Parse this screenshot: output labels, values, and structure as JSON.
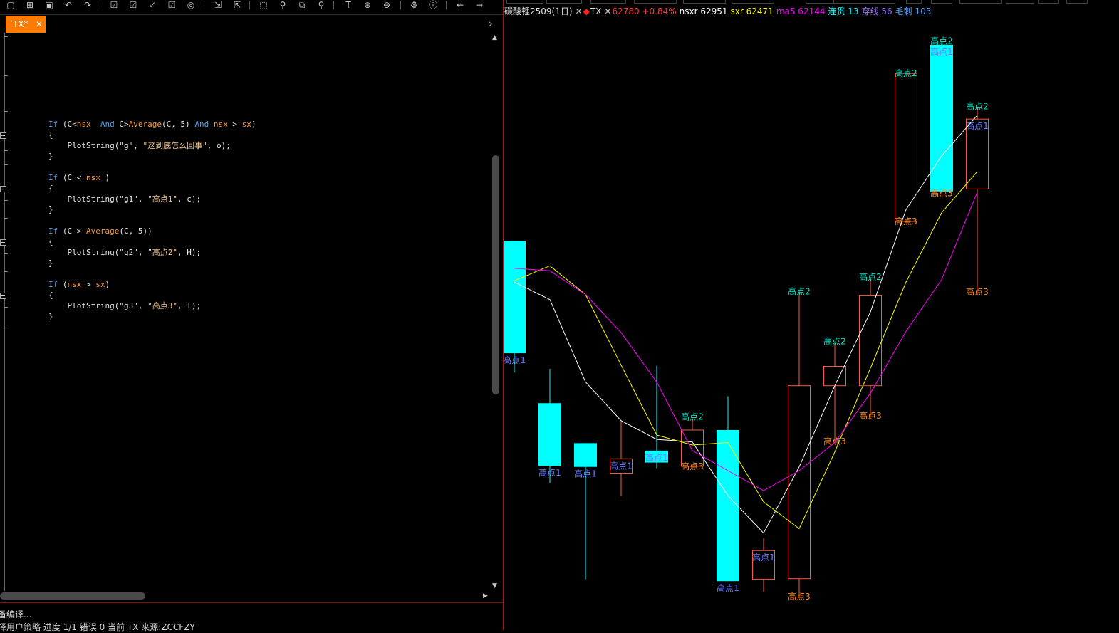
{
  "toolbar": {
    "icons": [
      "new-window-icon",
      "add-icon",
      "delete-icon",
      "undo-icon",
      "redo-icon",
      "check-icon",
      "check-doc-icon",
      "compile-icon",
      "check-all-icon",
      "stop-icon",
      "import-icon",
      "export-icon",
      "select-icon",
      "search-icon",
      "find-replace-icon",
      "zoom-search-icon",
      "text-cursor-icon",
      "zoom-in-icon",
      "zoom-out-icon",
      "settings-icon",
      "info-icon",
      "back-arrow-icon",
      "forward-arrow-icon"
    ]
  },
  "tab": {
    "label": "TX*",
    "close": "✕",
    "scroll_right": "›"
  },
  "editor": {
    "lines": [
      [
        {
          "c": "kw",
          "t": "If"
        },
        {
          "c": "tx",
          "t": " (C<"
        },
        {
          "c": "fn",
          "t": "nsx"
        },
        {
          "c": "tx",
          "t": "  "
        },
        {
          "c": "kw",
          "t": "And"
        },
        {
          "c": "tx",
          "t": " C>"
        },
        {
          "c": "fn",
          "t": "Average"
        },
        {
          "c": "tx",
          "t": "(C, 5) "
        },
        {
          "c": "kw",
          "t": "And"
        },
        {
          "c": "tx",
          "t": " "
        },
        {
          "c": "fn",
          "t": "nsx"
        },
        {
          "c": "tx",
          "t": " > "
        },
        {
          "c": "fn",
          "t": "sx"
        },
        {
          "c": "tx",
          "t": ")"
        }
      ],
      [
        {
          "c": "tx",
          "t": "{"
        }
      ],
      [
        {
          "c": "tx",
          "t": "    PlotString(\"g\", "
        },
        {
          "c": "st",
          "t": "\"这到底怎么回事\""
        },
        {
          "c": "tx",
          "t": ", o);"
        }
      ],
      [
        {
          "c": "tx",
          "t": "}"
        }
      ],
      [
        {
          "c": "kw",
          "t": "If"
        },
        {
          "c": "tx",
          "t": " (C < "
        },
        {
          "c": "fn",
          "t": "nsx"
        },
        {
          "c": "tx",
          "t": " )"
        }
      ],
      [
        {
          "c": "tx",
          "t": "{"
        }
      ],
      [
        {
          "c": "tx",
          "t": "    PlotString(\"g1\", "
        },
        {
          "c": "st",
          "t": "\"高点1\""
        },
        {
          "c": "tx",
          "t": ", c);"
        }
      ],
      [
        {
          "c": "tx",
          "t": "}"
        }
      ],
      [
        {
          "c": "kw",
          "t": "If"
        },
        {
          "c": "tx",
          "t": " (C > "
        },
        {
          "c": "fn",
          "t": "Average"
        },
        {
          "c": "tx",
          "t": "(C, 5))"
        }
      ],
      [
        {
          "c": "tx",
          "t": "{"
        }
      ],
      [
        {
          "c": "tx",
          "t": "    PlotString(\"g2\", "
        },
        {
          "c": "st",
          "t": "\"高点2\""
        },
        {
          "c": "tx",
          "t": ", H);"
        }
      ],
      [
        {
          "c": "tx",
          "t": "}"
        }
      ],
      [
        {
          "c": "kw",
          "t": "If"
        },
        {
          "c": "tx",
          "t": " ("
        },
        {
          "c": "fn",
          "t": "nsx"
        },
        {
          "c": "tx",
          "t": " > "
        },
        {
          "c": "fn",
          "t": "sx"
        },
        {
          "c": "tx",
          "t": ")"
        }
      ],
      [
        {
          "c": "tx",
          "t": "{"
        }
      ],
      [
        {
          "c": "tx",
          "t": "    PlotString(\"g3\", "
        },
        {
          "c": "st",
          "t": "\"高点3\""
        },
        {
          "c": "tx",
          "t": ", l);"
        }
      ],
      [
        {
          "c": "tx",
          "t": "}"
        }
      ]
    ]
  },
  "output": {
    "line1": "备编译...",
    "line2": "择用户策略  进度 1/1  错误 0  当前 TX 来源:ZCCFZY"
  },
  "chart": {
    "legend": [
      {
        "text": "碳酸锂2509(1日)",
        "color": "#e0e0e0"
      },
      {
        "text": "✕",
        "color": "#bbbbbb"
      },
      {
        "text": "◆",
        "color": "#ff2020"
      },
      {
        "text": "TX",
        "color": "#e0e0e0"
      },
      {
        "text": "✕",
        "color": "#bbbbbb"
      },
      {
        "text": "62780 +0.84%",
        "color": "#ff3b3b"
      },
      {
        "text": "nsxr 62951",
        "color": "#ffffff"
      },
      {
        "text": "sxr 62471",
        "color": "#ffff00"
      },
      {
        "text": "ma5 62144",
        "color": "#ff00ff"
      },
      {
        "text": "连贯 13",
        "color": "#00ffff"
      },
      {
        "text": "穿线 56",
        "color": "#a070ff"
      },
      {
        "text": "毛刺 103",
        "color": "#4d9fff"
      }
    ],
    "colors": {
      "up": "#ff5a3c",
      "down": "#00ffff",
      "nsxr": "#ffffff",
      "sxr": "#ffff00",
      "ma5": "#ff00ff",
      "g1": "#6b7dff",
      "g2": "#00e6c8",
      "g3": "#ff8c1a"
    }
  },
  "chart_data": {
    "type": "candlestick",
    "instrument": "碳酸锂2509",
    "candles": [
      {
        "o": 62800,
        "c": 61900,
        "h": 62800,
        "l": 61745,
        "dir": "down",
        "labels": [
          {
            "t": "高点1",
            "k": "g1"
          }
        ]
      },
      {
        "o": 61500,
        "c": 61000,
        "h": 61775,
        "l": 60860,
        "dir": "down",
        "labels": [
          {
            "t": "高点1",
            "k": "g1"
          }
        ]
      },
      {
        "o": 61180,
        "c": 60990,
        "h": 61180,
        "l": 60090,
        "dir": "down",
        "labels": [
          {
            "t": "高点1",
            "k": "g1"
          }
        ]
      },
      {
        "o": 60940,
        "c": 61055,
        "h": 61355,
        "l": 60755,
        "dir": "up",
        "labels": [
          {
            "t": "高点1",
            "k": "g1"
          }
        ]
      },
      {
        "o": 61025,
        "c": 61120,
        "h": 61800,
        "l": 60980,
        "dir": "down",
        "labels": [
          {
            "t": "高点1",
            "k": "g1"
          }
        ]
      },
      {
        "o": 60995,
        "c": 61285,
        "h": 61390,
        "l": 60995,
        "dir": "up",
        "labels": [
          {
            "t": "高点2",
            "k": "g2"
          },
          {
            "t": "高点3",
            "k": "g3"
          }
        ]
      },
      {
        "o": 61285,
        "c": 60075,
        "h": 61555,
        "l": 60075,
        "dir": "down",
        "labels": [
          {
            "t": "高点1",
            "k": "g1"
          }
        ]
      },
      {
        "o": 60090,
        "c": 60320,
        "h": 60420,
        "l": 59990,
        "dir": "up",
        "labels": [
          {
            "t": "高点1",
            "k": "g1"
          }
        ]
      },
      {
        "o": 60095,
        "c": 61640,
        "h": 62395,
        "l": 59950,
        "dir": "up",
        "labels": [
          {
            "t": "高点2",
            "k": "g2"
          },
          {
            "t": "高点3",
            "k": "g3"
          }
        ]
      },
      {
        "o": 61640,
        "c": 61795,
        "h": 61995,
        "l": 61195,
        "dir": "up",
        "labels": [
          {
            "t": "高点2",
            "k": "g2"
          },
          {
            "t": "高点3",
            "k": "g3"
          }
        ]
      },
      {
        "o": 61640,
        "c": 62360,
        "h": 62510,
        "l": 61400,
        "dir": "up",
        "labels": [
          {
            "t": "高点2",
            "k": "g2"
          },
          {
            "t": "高点3",
            "k": "g3"
          }
        ]
      },
      {
        "o": 62955,
        "c": 64140,
        "h": 64140,
        "l": 62955,
        "dir": "up",
        "labels": [
          {
            "t": "高点2",
            "k": "g2"
          },
          {
            "t": "高点3",
            "k": "g3"
          }
        ]
      },
      {
        "o": 63195,
        "c": 64370,
        "h": 64400,
        "l": 63180,
        "dir": "down",
        "labels": [
          {
            "t": "高点2",
            "k": "g2"
          },
          {
            "t": "高点1",
            "k": "g1"
          },
          {
            "t": "高点3",
            "k": "g3"
          }
        ]
      },
      {
        "o": 63215,
        "c": 63775,
        "h": 63875,
        "l": 62390,
        "dir": "up",
        "labels": [
          {
            "t": "高点2",
            "k": "g2"
          },
          {
            "t": "高点1",
            "k": "g1"
          },
          {
            "t": "高点3",
            "k": "g3"
          }
        ]
      }
    ],
    "series": [
      {
        "name": "nsxr",
        "values": [
          62470,
          62330,
          61670,
          61360,
          61210,
          61190,
          60760,
          60460,
          60990,
          61640,
          62230,
          63050,
          63480,
          63805
        ]
      },
      {
        "name": "sxr",
        "values": [
          62480,
          62600,
          62370,
          61805,
          61245,
          61165,
          61185,
          60710,
          60495,
          61110,
          61780,
          62470,
          63025,
          63355
        ]
      },
      {
        "name": "ma5",
        "values": [
          62580,
          62560,
          62370,
          62065,
          61670,
          61120,
          60960,
          60800,
          60960,
          61185,
          61580,
          62075,
          62490,
          63190
        ]
      }
    ]
  }
}
